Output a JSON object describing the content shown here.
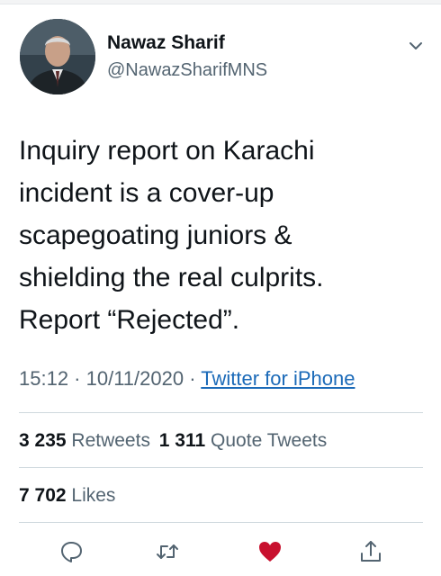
{
  "author": {
    "name": "Nawaz Sharif",
    "handle": "@NawazSharifMNS"
  },
  "tweet": {
    "text": "Inquiry report on Karachi\nincident is a cover-up\nscapegoating juniors &\nshielding the real culprits.\nReport “Rejected”."
  },
  "meta": {
    "time": "15:12",
    "sep1": " · ",
    "date": "10/11/2020",
    "sep2": " · ",
    "source": "Twitter for iPhone"
  },
  "stats": {
    "retweets_count": "3 235",
    "retweets_label": "Retweets",
    "quotes_count": "1 311",
    "quotes_label": "Quote Tweets",
    "likes_count": "7 702",
    "likes_label": "Likes"
  },
  "actions": {
    "reply_icon": "reply-icon",
    "retweet_icon": "retweet-icon",
    "like_icon": "heart-filled-icon",
    "share_icon": "share-icon"
  },
  "colors": {
    "text": "#0f1419",
    "muted": "#536471",
    "link": "#1b6ab8",
    "liked": "#c8102e"
  }
}
